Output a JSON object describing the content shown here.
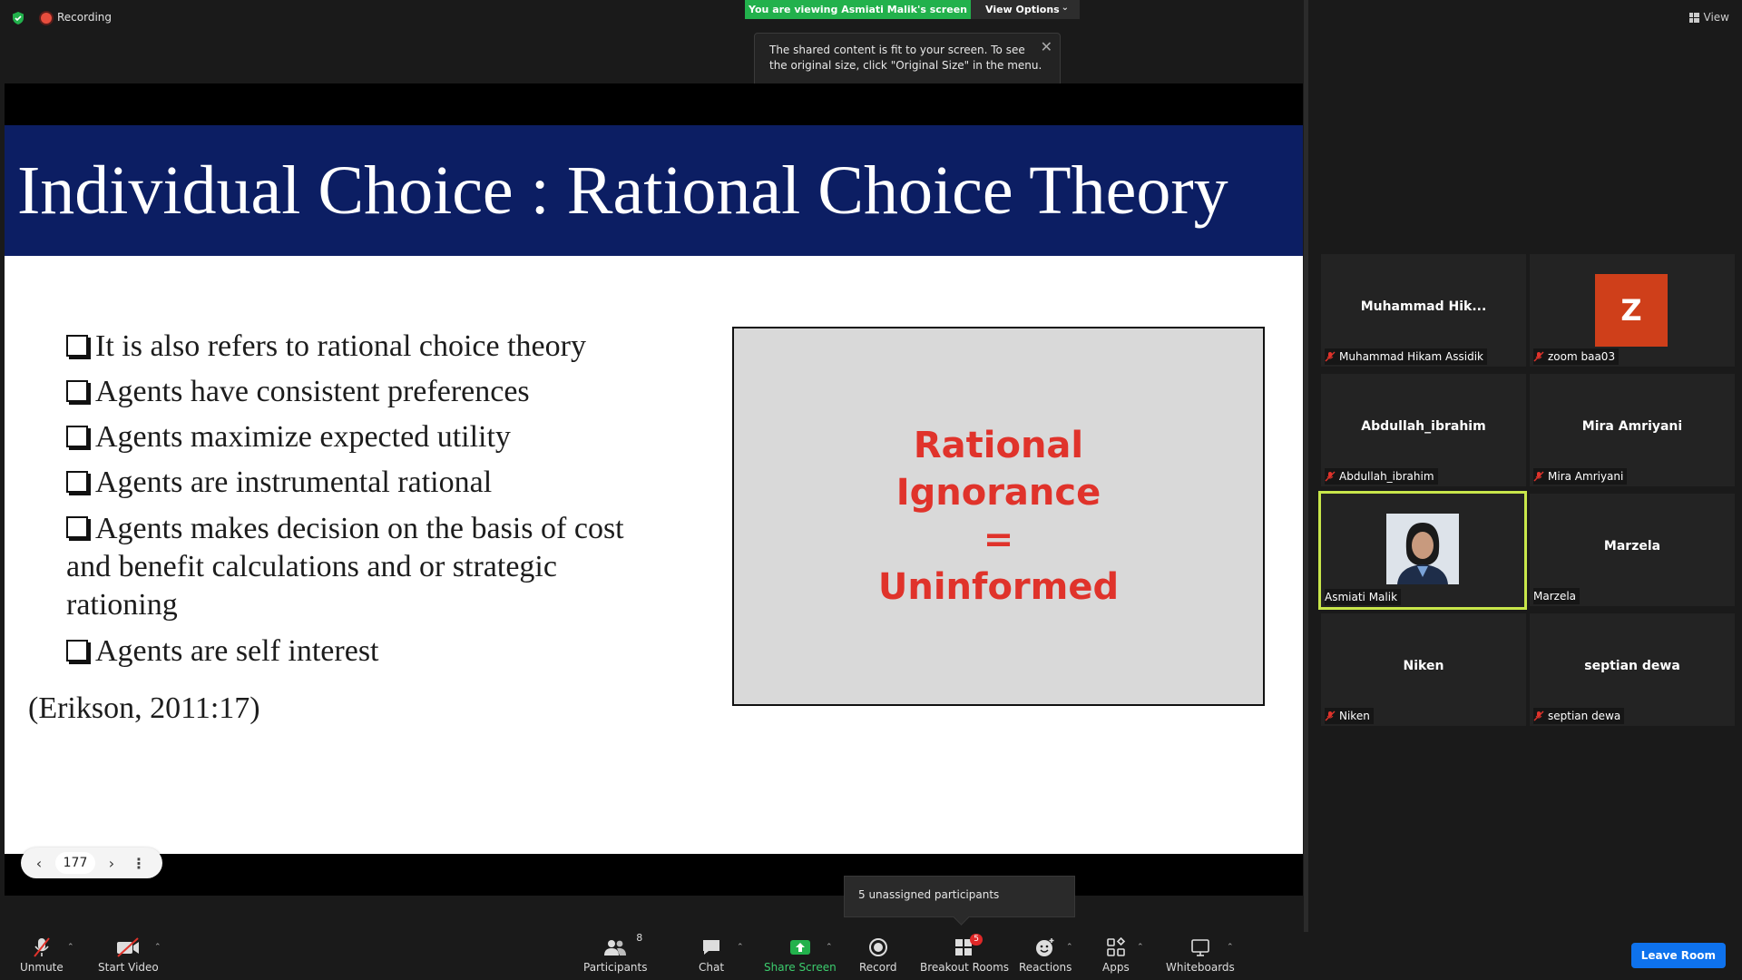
{
  "topbar": {
    "recording_label": "Recording",
    "viewing_banner": "You are viewing Asmiati Malik's screen",
    "view_options_label": "View Options",
    "view_label": "View",
    "tooltip_text": "The shared content is fit to your screen. To see the original size, click \"Original Size\" in the menu."
  },
  "slide": {
    "title": "Individual Choice : Rational Choice Theory",
    "bullets": [
      "It is also refers to rational choice theory",
      "Agents have consistent preferences",
      "Agents maximize expected utility",
      "Agents are instrumental rational",
      "Agents makes decision on the basis of cost",
      "Agents are self interest"
    ],
    "bullet_4_cont1": "and benefit calculations and or strategic",
    "bullet_4_cont2": "rationing",
    "citation": "(Erikson, 2011:17)",
    "box_lines": [
      "Rational",
      "Ignorance",
      "=",
      "Uninformed"
    ],
    "page_number": "177"
  },
  "gallery": {
    "tiles": [
      {
        "center": "Muhammad  Hik...",
        "label": "Muhammad Hikam Assidik"
      },
      {
        "avatar": "Z",
        "label": "zoom baa03"
      },
      {
        "center": "Abdullah_ibrahim",
        "label": "Abdullah_ibrahim"
      },
      {
        "center": "Mira Amriyani",
        "label": "Mira Amriyani"
      },
      {
        "label": "Asmiati Malik"
      },
      {
        "center": "Marzela",
        "label": "Marzela"
      },
      {
        "center": "Niken",
        "label": "Niken"
      },
      {
        "center": "septian dewa",
        "label": "septian dewa"
      }
    ]
  },
  "popup": {
    "unassigned": "5 unassigned participants"
  },
  "toolbar": {
    "unmute": "Unmute",
    "start_video": "Start Video",
    "participants": "Participants",
    "participants_count": "8",
    "chat": "Chat",
    "share_screen": "Share Screen",
    "record": "Record",
    "breakout_rooms": "Breakout Rooms",
    "breakout_badge": "5",
    "reactions": "Reactions",
    "apps": "Apps",
    "whiteboards": "Whiteboards",
    "leave_room": "Leave Room"
  },
  "colors": {
    "active_speaker": "#c8e64a",
    "title_band": "#0c1e63",
    "ri_text": "#e0332b",
    "share_green": "#22b14c",
    "leave_blue": "#0e72ed"
  }
}
